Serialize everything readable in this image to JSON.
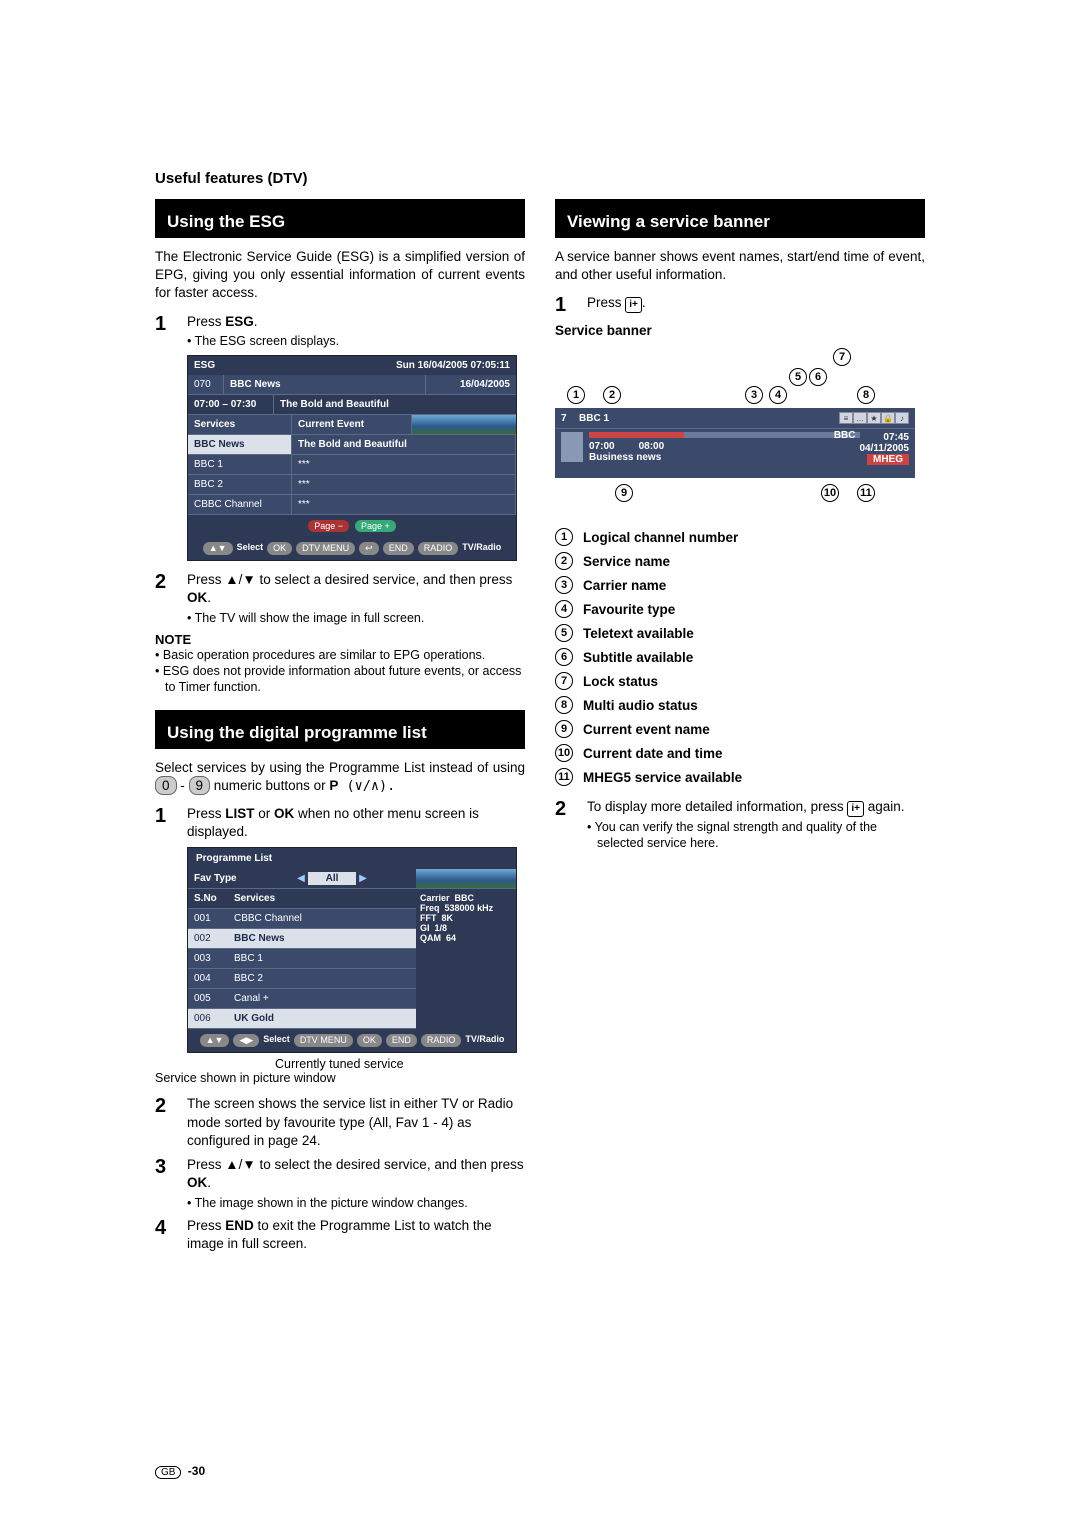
{
  "page": {
    "section_title": "Useful features (DTV)",
    "footer_page": "-30",
    "footer_region": "GB"
  },
  "left": {
    "h1": "Using the ESG",
    "intro": "The Electronic Service Guide (ESG) is a simplified version of EPG, giving you only essential information of current events for faster access.",
    "step1_label": "1",
    "step1_text_a": "Press ",
    "step1_text_b": "ESG",
    "step1_text_c": ".",
    "step1_sub": "The ESG screen displays.",
    "esg": {
      "title": "ESG",
      "datetime": "Sun  16/04/2005  07:05:11",
      "ch_no": "070",
      "ch_name": "BBC News",
      "date": "16/04/2005",
      "time_range": "07:00 – 07:30",
      "event_title": "The Bold and Beautiful",
      "col_services": "Services",
      "col_event": "Current Event",
      "rows": [
        {
          "s": "BBC News",
          "e": "The Bold and Beautiful"
        },
        {
          "s": "BBC 1",
          "e": "***"
        },
        {
          "s": "BBC 2",
          "e": "***"
        },
        {
          "s": "CBBC Channel",
          "e": "***"
        }
      ],
      "page_minus": "Page −",
      "page_plus": "Page +",
      "btn_select": "Select",
      "btn_ok": "OK",
      "btn_dtv": "DTV MENU",
      "btn_end": "END",
      "btn_radio": "RADIO",
      "btn_tvradio": "TV/Radio"
    },
    "step2_label": "2",
    "step2_text": "Press ▲/▼ to select a desired service, and then press ",
    "step2_ok": "OK",
    "step2_end": ".",
    "step2_sub": "The TV will show the image in full screen.",
    "note_h": "NOTE",
    "note1": "Basic operation procedures are similar to EPG operations.",
    "note2": "ESG does not provide information about future events, or access to Timer function.",
    "h2": "Using the digital programme list",
    "prog_intro_a": "Select services by using the Programme List instead of using ",
    "prog_intro_b": " numeric buttons or ",
    "prog_intro_c": "P",
    "prog_intro_d": " (∨/∧).",
    "zero": "0",
    "nine": "9",
    "pstep1_label": "1",
    "pstep1_a": "Press ",
    "pstep1_b": "LIST",
    "pstep1_c": " or ",
    "pstep1_d": "OK",
    "pstep1_e": " when no other menu screen is displayed.",
    "prog": {
      "title": "Programme List",
      "fav": "Fav Type",
      "all": "All",
      "col_sno": "S.No",
      "col_services": "Services",
      "rows": [
        {
          "n": "001",
          "s": "CBBC Channel"
        },
        {
          "n": "002",
          "s": "BBC News"
        },
        {
          "n": "003",
          "s": "BBC 1"
        },
        {
          "n": "004",
          "s": "BBC 2"
        },
        {
          "n": "005",
          "s": "Canal +"
        },
        {
          "n": "006",
          "s": "UK Gold"
        }
      ],
      "info": {
        "k1": "Carrier",
        "v1": "BBC",
        "k2": "Freq",
        "v2": "538000 kHz",
        "k3": "FFT",
        "v3": "8K",
        "k4": "GI",
        "v4": "1/8",
        "k5": "QAM",
        "v5": "64"
      },
      "btn_select": "Select",
      "btn_dtv": "DTV MENU",
      "btn_ok": "OK",
      "btn_end": "END",
      "btn_radio": "RADIO",
      "btn_tvradio": "TV/Radio"
    },
    "callout1": "Currently tuned service",
    "callout2": "Service shown in picture window",
    "pstep2_label": "2",
    "pstep2": "The screen shows the service list in either TV or Radio mode sorted by favourite type (All, Fav 1 - 4) as configured in page 24.",
    "pstep3_label": "3",
    "pstep3_a": "Press ▲/▼ to select the desired service, and then press ",
    "pstep3_b": "OK",
    "pstep3_c": ".",
    "pstep3_sub": "The image shown in the picture window changes.",
    "pstep4_label": "4",
    "pstep4_a": "Press ",
    "pstep4_b": "END",
    "pstep4_c": " to exit the Programme List to watch the image in full screen."
  },
  "right": {
    "h1": "Viewing a service banner",
    "intro": "A service banner shows event names, start/end time of event, and other useful information.",
    "step1_label": "1",
    "step1_a": "Press ",
    "step1_b": ".",
    "sb_h": "Service banner",
    "banner": {
      "ch_no": "7",
      "ch_name": "BBC 1",
      "carrier": "BBC",
      "t1": "07:00",
      "t2": "08:00",
      "event": "Business news",
      "endtime": "07:45",
      "date": "04/11/2005",
      "mheg": "MHEG"
    },
    "legend": {
      "l1": "Logical channel number",
      "l2": "Service name",
      "l3": "Carrier name",
      "l4": "Favourite type",
      "l5": "Teletext available",
      "l6": "Subtitle available",
      "l7": "Lock status",
      "l8": "Multi audio status",
      "l9": "Current event name",
      "l10": "Current date and time",
      "l11": "MHEG5 service available"
    },
    "step2_label": "2",
    "step2_a": "To display more detailed information, press ",
    "step2_b": " again.",
    "step2_sub": "You can verify the signal strength and quality of the selected service here."
  }
}
